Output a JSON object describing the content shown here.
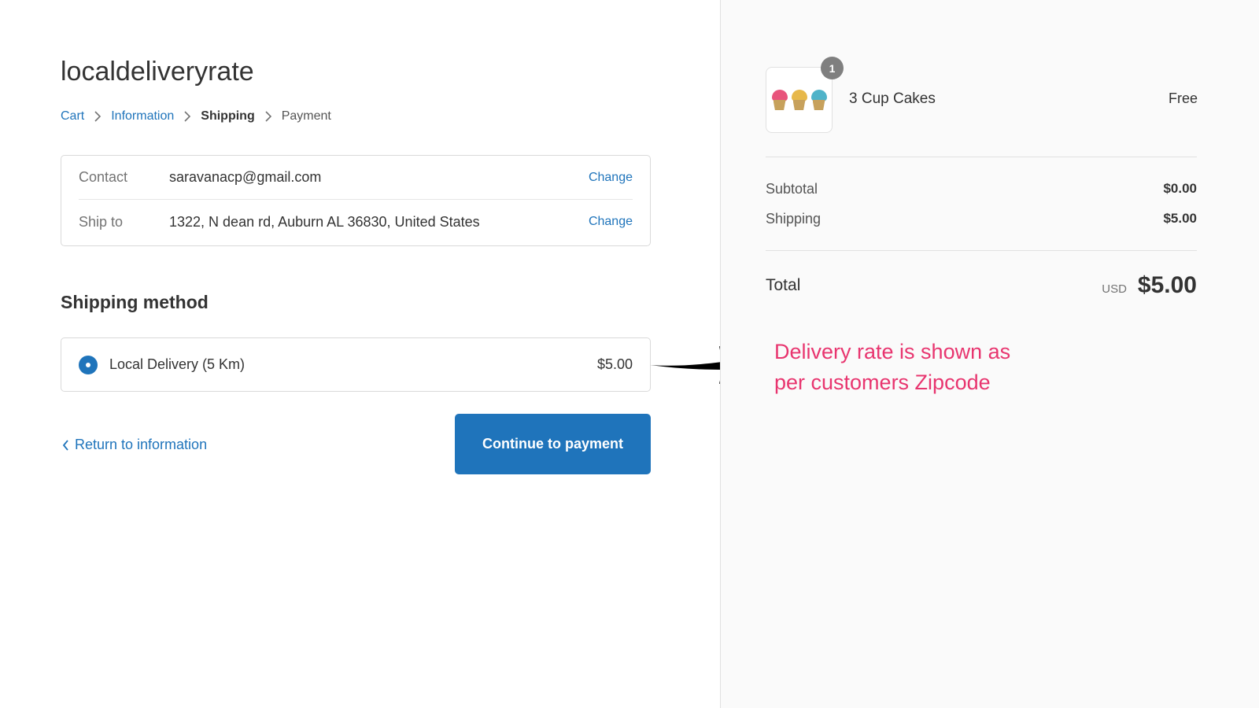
{
  "store": {
    "name": "localdeliveryrate"
  },
  "breadcrumb": {
    "items": [
      {
        "label": "Cart"
      },
      {
        "label": "Information"
      },
      {
        "label": "Shipping"
      },
      {
        "label": "Payment"
      }
    ]
  },
  "review": {
    "contact": {
      "label": "Contact",
      "value": "saravanacp@gmail.com",
      "change": "Change"
    },
    "ship_to": {
      "label": "Ship to",
      "value": "1322, N dean rd, Auburn AL 36830, United States",
      "change": "Change"
    }
  },
  "shipping_method": {
    "title": "Shipping method",
    "option": {
      "label": "Local Delivery (5 Km)",
      "price": "$5.00",
      "selected": true
    }
  },
  "navigation": {
    "return_label": "Return to information",
    "continue_label": "Continue to payment"
  },
  "order": {
    "product": {
      "name": "3 Cup Cakes",
      "price": "Free",
      "quantity": "1"
    },
    "subtotal": {
      "label": "Subtotal",
      "value": "$0.00"
    },
    "shipping": {
      "label": "Shipping",
      "value": "$5.00"
    },
    "total": {
      "label": "Total",
      "currency": "USD",
      "value": "$5.00"
    }
  },
  "annotation": {
    "line1": "Delivery rate is shown as",
    "line2": "per customers Zipcode"
  },
  "colors": {
    "accent": "#1f74bb",
    "annotation": "#e8356f",
    "sidebar_bg": "#fafafa"
  }
}
